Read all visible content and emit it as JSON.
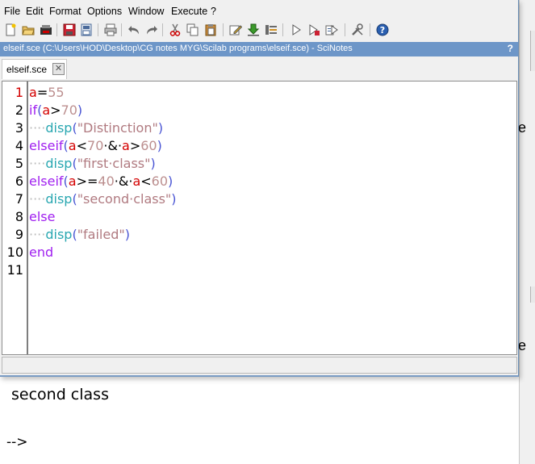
{
  "menu": [
    "File",
    "Edit",
    "Format",
    "Options",
    "Window",
    "Execute",
    "?"
  ],
  "toolbar_icons": [
    "new-file-icon",
    "open-folder-icon",
    "open-recent-icon",
    "save-icon",
    "save-as-icon",
    "print-icon",
    "undo-icon",
    "redo-icon",
    "cut-icon",
    "copy-icon",
    "paste-icon",
    "comment-icon",
    "download-icon",
    "indent-icon",
    "execute-icon",
    "execute-file-icon",
    "execute-until-icon",
    "settings-icon",
    "help-icon"
  ],
  "window_title": "elseif.sce (C:\\Users\\HOD\\Desktop\\CG notes MYG\\Scilab programs\\elseif.sce) - SciNotes",
  "help_glyph": "?",
  "tab": {
    "label": "elseif.sce",
    "close_glyph": "✕"
  },
  "line_numbers": [
    "1",
    "2",
    "3",
    "4",
    "5",
    "6",
    "7",
    "8",
    "9",
    "10",
    "11"
  ],
  "code": {
    "l1": {
      "var": "a",
      "op": "=",
      "num": "55"
    },
    "l2": {
      "kw": "if",
      "p1": "(",
      "var": "a",
      "op": ">",
      "num": "70",
      "p2": ")"
    },
    "l3": {
      "ws": "····",
      "fn": "disp",
      "p1": "(",
      "str": "\"Distinction\"",
      "p2": ")"
    },
    "l4": {
      "kw": "elseif",
      "p1": "(",
      "v1": "a",
      "o1": "<",
      "n1": "70",
      "and": "·&·",
      "v2": "a",
      "o2": ">",
      "n2": "60",
      "p2": ")"
    },
    "l5": {
      "ws": "····",
      "fn": "disp",
      "p1": "(",
      "str": "\"first·class\"",
      "p2": ")"
    },
    "l6": {
      "kw": "elseif",
      "p1": "(",
      "v1": "a",
      "o1": ">=",
      "n1": "40",
      "and": "·&·",
      "v2": "a",
      "o2": "<",
      "n2": "60",
      "p2": ")"
    },
    "l7": {
      "ws": "····",
      "fn": "disp",
      "p1": "(",
      "str": "\"second·class\"",
      "p2": ")"
    },
    "l8": {
      "kw": "else"
    },
    "l9": {
      "ws": "····",
      "fn": "disp",
      "p1": "(",
      "str": "\"failed\"",
      "p2": ")"
    },
    "l10": {
      "kw": "end"
    }
  },
  "console": {
    "output": "second class",
    "prompt": "-->",
    "partial_char": "e"
  }
}
